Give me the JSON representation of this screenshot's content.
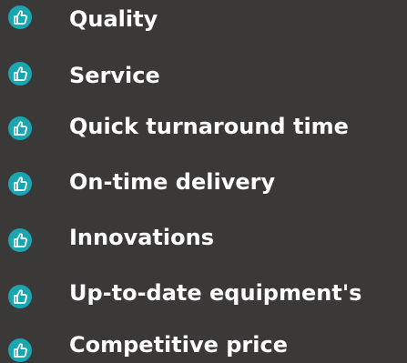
{
  "colors": {
    "background": "#3b3838",
    "text": "#ffffff",
    "icon_fill": "#19a6b0",
    "icon_stroke": "#ffffff"
  },
  "icon": "thumbs-up-icon",
  "items": [
    {
      "label": "Quality"
    },
    {
      "label": "Service"
    },
    {
      "label": "Quick turnaround time"
    },
    {
      "label": "On-time delivery"
    },
    {
      "label": "Innovations"
    },
    {
      "label": "Up-to-date equipment's"
    },
    {
      "label": "Competitive price"
    }
  ]
}
